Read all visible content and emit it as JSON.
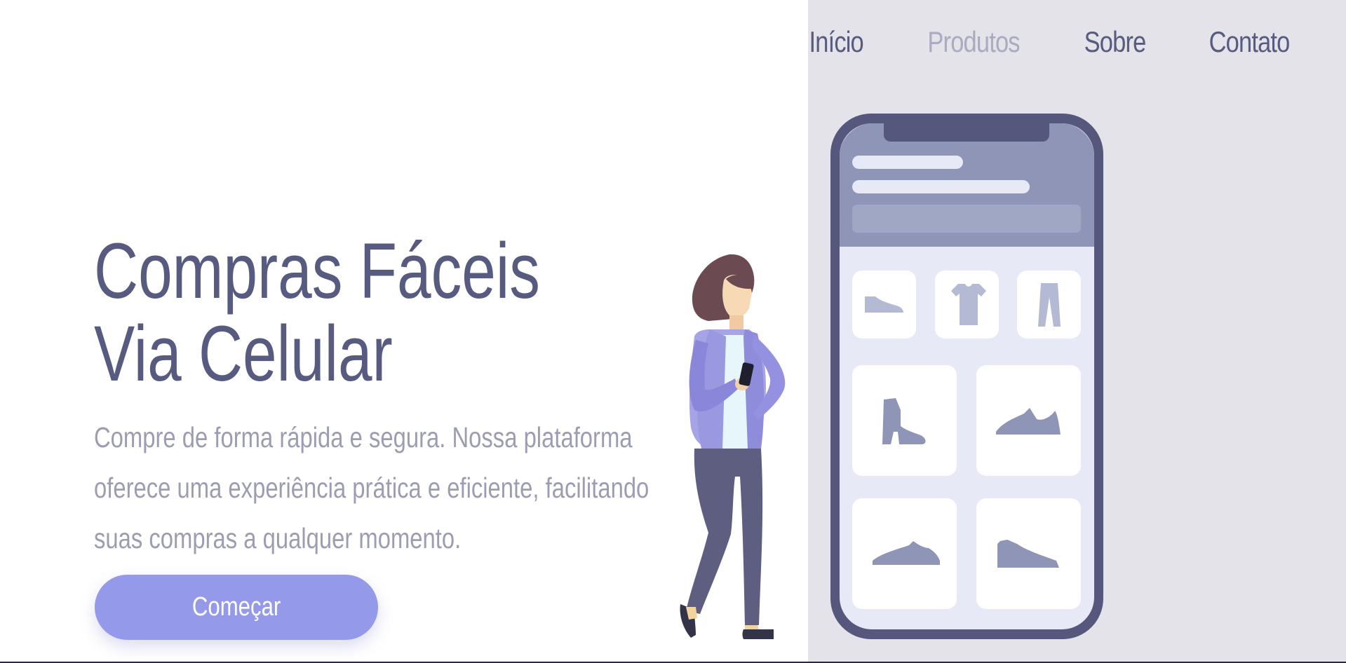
{
  "nav": {
    "items": [
      {
        "label": "Início",
        "active": false
      },
      {
        "label": "Produtos",
        "active": true
      },
      {
        "label": "Sobre",
        "active": false
      },
      {
        "label": "Contato",
        "active": false
      }
    ]
  },
  "hero": {
    "title_line1": "Compras Fáceis",
    "title_line2": "Via Celular",
    "subtitle": "Compre de forma rápida e segura. Nossa plataforma oferece uma experiência prática e eficiente, facilitando suas compras a qualquer momento.",
    "cta_label": "Começar"
  },
  "illustration": {
    "person": "woman-holding-phone",
    "phone_products": [
      "sneaker-icon",
      "tshirt-icon",
      "pants-icon",
      "boot-icon",
      "running-shoe-icon",
      "sneaker-icon",
      "sneaker-icon"
    ]
  },
  "colors": {
    "accent": "#9499e9",
    "heading": "#565b7f",
    "muted_text": "#9c9db3",
    "panel_bg": "#e4e3e9",
    "phone_frame": "#56577c",
    "phone_header": "#8e95b6",
    "phone_screen": "#e7e9f6"
  }
}
